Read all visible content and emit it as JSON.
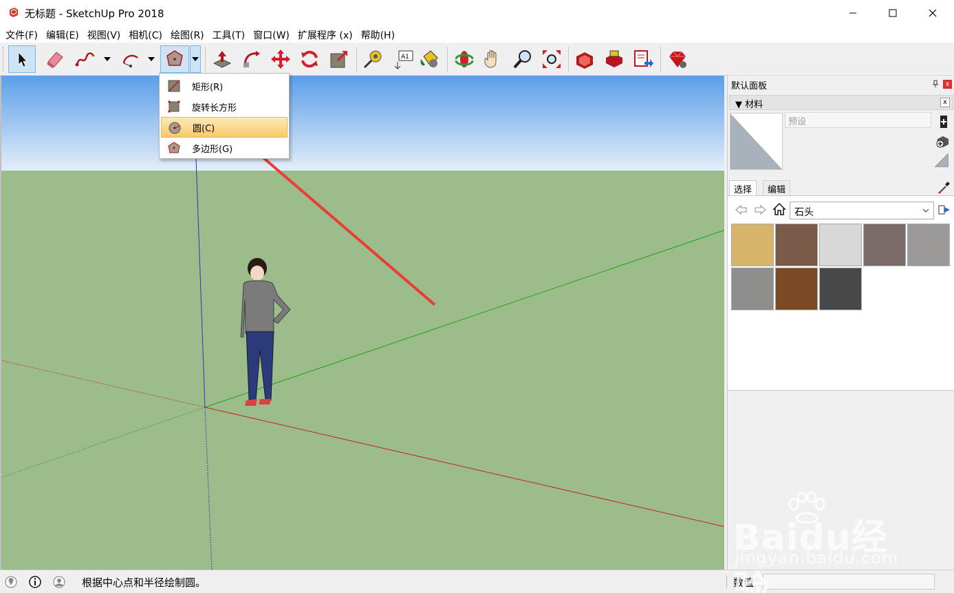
{
  "window": {
    "title": "无标题 - SketchUp Pro 2018"
  },
  "menubar": {
    "items": [
      "文件(F)",
      "编辑(E)",
      "视图(V)",
      "相机(C)",
      "绘图(R)",
      "工具(T)",
      "窗口(W)",
      "扩展程序 (x)",
      "帮助(H)"
    ]
  },
  "toolbar": {
    "tools": [
      "select",
      "eraser",
      "freehand",
      "arc",
      "shapes",
      "push-pull",
      "follow-me",
      "move",
      "rotate",
      "scale",
      "tape-measure",
      "text",
      "paint-bucket",
      "orbit",
      "pan",
      "zoom",
      "zoom-extents",
      "warehouse",
      "extension-warehouse",
      "send-to-layout",
      "extension-manager"
    ],
    "active_tool": "shapes"
  },
  "shapes_menu": {
    "items": [
      {
        "label": "矩形(R)",
        "icon": "rectangle-icon"
      },
      {
        "label": "旋转长方形",
        "icon": "rotated-rectangle-icon"
      },
      {
        "label": "圆(C)",
        "icon": "circle-icon",
        "highlighted": true
      },
      {
        "label": "多边形(G)",
        "icon": "polygon-icon"
      }
    ]
  },
  "panel": {
    "title": "默认面板",
    "close_glyph": "x",
    "materials": {
      "header": "▼ 材料",
      "close_glyph": "x",
      "name_placeholder": "预设",
      "tabs": [
        "选择",
        "编辑"
      ],
      "library": "石头",
      "swatches": [
        "#d9b46c",
        "#7a5a48",
        "#d8d8d8",
        "#7a6a68",
        "#9c9a98",
        "#8e8e8c",
        "#7a4a26",
        "#484848"
      ]
    }
  },
  "statusbar": {
    "hint": "根据中心点和半径绘制圆。",
    "vcb_label": "数值",
    "vcb_value": ""
  },
  "watermark": {
    "word": "Baidu经验",
    "sub": "jingyan.baidu.com"
  },
  "colors": {
    "sky_top": "#5b9ee9",
    "sky_bottom": "#e4eef8",
    "ground": "#9cbc8c",
    "axis_red": "#c8221a",
    "axis_green": "#1aa61a",
    "axis_blue": "#2a38a8",
    "annotation_arrow": "#ea3c34"
  }
}
